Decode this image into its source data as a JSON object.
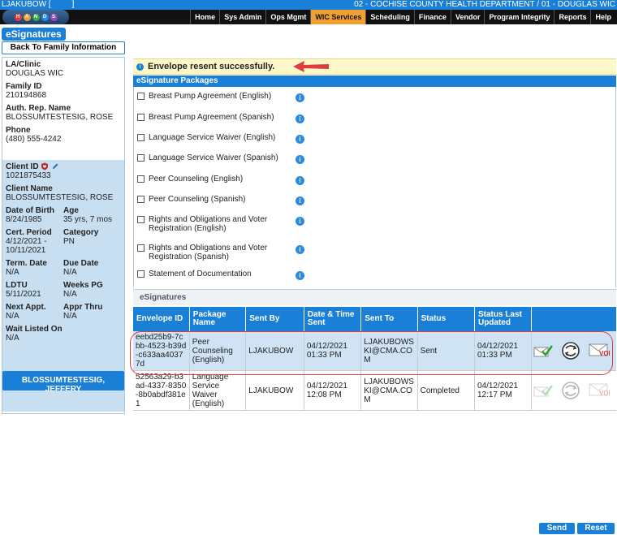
{
  "header": {
    "user": "LJAKUBOW [",
    "user_suffix": "]",
    "dept": "02 - COCHISE COUNTY HEALTH DEPARTMENT / 01 - DOUGLAS WIC",
    "logo_letters": [
      "H",
      "A",
      "N",
      "D",
      "S"
    ]
  },
  "nav": [
    "Home",
    "Sys Admin",
    "Ops Mgmt",
    "WIC Services",
    "Scheduling",
    "Finance",
    "Vendor",
    "Program Integrity",
    "Reports",
    "Help"
  ],
  "nav_active": "WIC Services",
  "page_title": "eSignatures",
  "back_button": "Back To Family Information",
  "family": {
    "la_clinic_label": "LA/Clinic",
    "la_clinic": "DOUGLAS WIC",
    "family_id_label": "Family ID",
    "family_id": "210194868",
    "auth_rep_label": "Auth. Rep. Name",
    "auth_rep": "BLOSSUMTESTESIG, ROSE",
    "phone_label": "Phone",
    "phone": "(480) 555-4242"
  },
  "client": {
    "client_id_label": "Client ID",
    "client_id": "1021875433",
    "client_name_label": "Client Name",
    "client_name": "BLOSSUMTESTESIG, ROSE",
    "dob_label": "Date of Birth",
    "dob": "8/24/1985",
    "age_label": "Age",
    "age": "35 yrs, 7 mos",
    "cert_label": "Cert. Period",
    "cert": "4/12/2021 - 10/11/2021",
    "category_label": "Category",
    "category": "PN",
    "term_label": "Term. Date",
    "term": "N/A",
    "due_label": "Due Date",
    "due": "N/A",
    "ldtu_label": "LDTU",
    "ldtu": "5/11/2021",
    "weeks_label": "Weeks PG",
    "weeks": "N/A",
    "next_label": "Next Appt.",
    "next": "N/A",
    "appr_label": "Appr Thru",
    "appr": "N/A",
    "wait_label": "Wait Listed On",
    "wait": "N/A"
  },
  "other_client_button": "BLOSSUMTESTESIG, JEFFERY",
  "alert": "Envelope resent successfully.",
  "packages_title": "eSignature Packages",
  "packages": [
    "Breast Pump Agreement (English)",
    "Breast Pump Agreement (Spanish)",
    "Language Service Waiver (English)",
    "Language Service Waiver (Spanish)",
    "Peer Counseling (English)",
    "Peer Counseling (Spanish)",
    "Rights and Obligations and Voter Registration (English)",
    "Rights and Obligations and Voter Registration (Spanish)",
    "Statement of Documentation"
  ],
  "esignatures_title": "eSignatures",
  "table": {
    "headers": [
      "Envelope ID",
      "Package Name",
      "Sent By",
      "Date & Time Sent",
      "Sent To",
      "Status",
      "Status Last Updated",
      ""
    ],
    "rows": [
      [
        "eebd25b9-7cbb-4523-b39d-c633aa40377d",
        "Peer Counseling (English)",
        "LJAKUBOW",
        "04/12/2021 01:33 PM",
        "LJAKUBOWSKI@CMA.COM",
        "Sent",
        "04/12/2021 01:33 PM"
      ],
      [
        "52563a29-b3ad-4337-8350-8b0abdf381e1",
        "Language Service Waiver (English)",
        "LJAKUBOW",
        "04/12/2021 12:08 PM",
        "LJAKUBOWSKI@CMA.COM",
        "Completed",
        "04/12/2021 12:17 PM"
      ]
    ]
  },
  "void_label": "VOID",
  "buttons": {
    "send": "Send",
    "reset": "Reset"
  },
  "colors": {
    "header_blue": "#1a7fd6",
    "active_tab": "#f0a030",
    "alert_bg": "#fdf7c9",
    "highlight": "#e03a3a"
  }
}
